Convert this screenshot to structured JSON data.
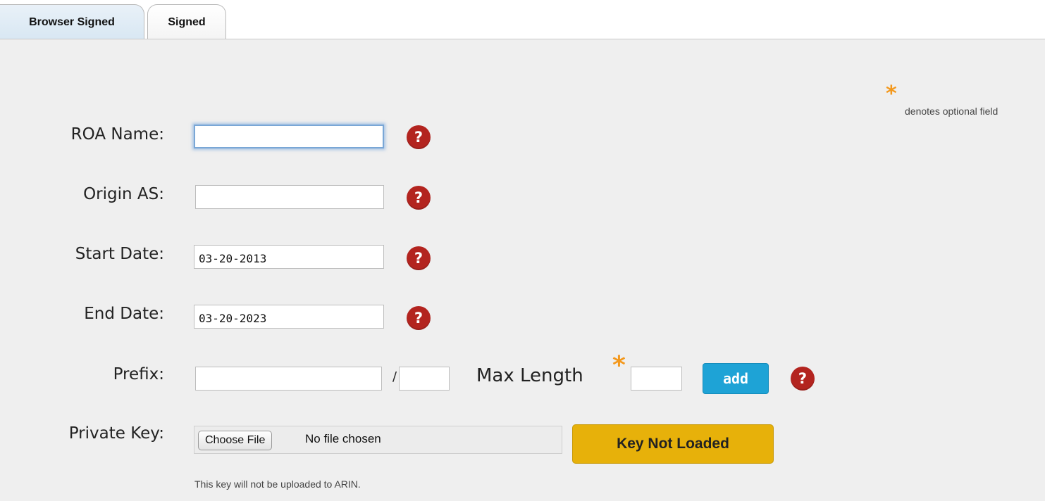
{
  "tabs": [
    {
      "label": "Browser Signed",
      "active": true
    },
    {
      "label": "Signed",
      "active": false
    }
  ],
  "legend": {
    "star": "*",
    "text": "denotes optional field"
  },
  "form": {
    "roa_name": {
      "label": "ROA Name:",
      "value": ""
    },
    "origin_as": {
      "label": "Origin AS:",
      "value": ""
    },
    "start_date": {
      "label": "Start Date:",
      "value": "03-20-2013"
    },
    "end_date": {
      "label": "End Date:",
      "value": "03-20-2023"
    },
    "prefix": {
      "label": "Prefix:",
      "value": "",
      "separator": "/",
      "length_value": "",
      "max_length_label": "Max Length",
      "max_length_value": "",
      "optional_star": "*",
      "add_label": "add"
    },
    "private_key": {
      "label": "Private Key:",
      "choose_label": "Choose File",
      "file_status": "No file chosen",
      "status_button": "Key Not Loaded",
      "note": "This key will not be uploaded to ARIN."
    }
  },
  "help_glyph": "?",
  "colors": {
    "help": "#b3241f",
    "add_button": "#1ea3d6",
    "key_button": "#e7b10a",
    "optional_star": "#f3981c",
    "active_tab": "#d8e7f3",
    "panel": "#efefef"
  }
}
